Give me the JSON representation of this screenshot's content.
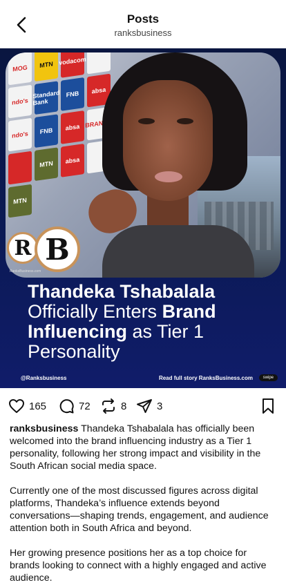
{
  "header": {
    "title": "Posts",
    "subtitle": "ranksbusiness"
  },
  "post_image": {
    "brand_tiles": [
      "MOG",
      "MTN",
      "vodacom",
      "ndo's",
      "Standard Bank",
      "FNB",
      "absa",
      "BRANDO",
      "ndo's",
      "FNB",
      "absa",
      "MTN",
      "absa",
      "MTN"
    ],
    "logo_r": "R",
    "logo_b": "B",
    "logo_caption": "RanksBusiness.com",
    "headline_line1": "Thandeka Tshabalala",
    "headline_line2_light": "Officially Enters ",
    "headline_line2_bold": "Brand",
    "headline_line3_bold": "Influencing",
    "headline_line3_light": " as Tier 1",
    "headline_line4": "Personality",
    "footer_left": "@Ranksbusiness",
    "footer_right": "Read full story RanksBusiness.com",
    "swipe_label": "swipe"
  },
  "actions": {
    "likes": "165",
    "comments": "72",
    "reposts": "8",
    "shares": "3"
  },
  "caption": {
    "username": "ranksbusiness",
    "para1": "Thandeka Tshabalala has officially been welcomed into the brand influencing industry as a Tier 1 personality, following her strong impact and visibility in the South African social media space.",
    "para2": "Currently one of the most discussed figures across digital platforms, Thandeka’s influence extends beyond conversations—shaping trends, engagement, and audience attention both in South Africa and beyond.",
    "para3": "Her growing presence positions her as a top choice for brands looking to connect with a highly engaged and active audience."
  },
  "colors": {
    "banner_blue": "#0b1a55",
    "logo_ring": "#c8935a"
  }
}
